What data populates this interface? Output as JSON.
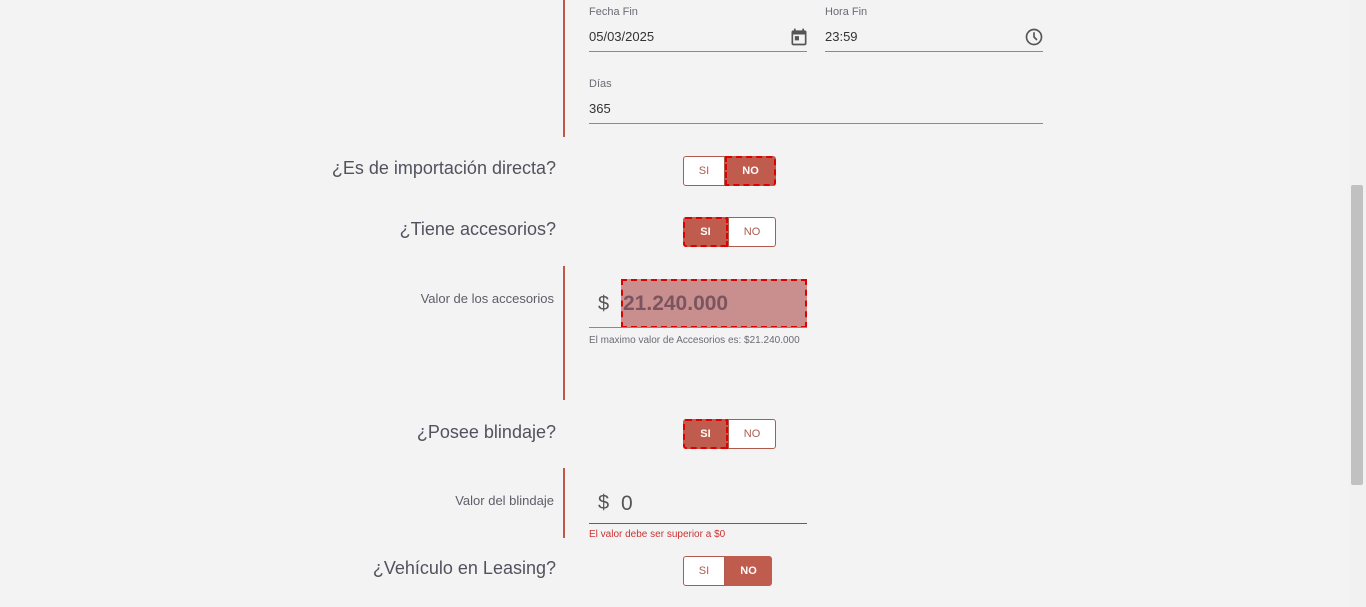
{
  "fecha_fin": {
    "label": "Fecha Fin",
    "value": "05/03/2025",
    "icon": "calendar-icon"
  },
  "hora_fin": {
    "label": "Hora Fin",
    "value": "23:59",
    "icon": "clock-icon"
  },
  "dias": {
    "label": "Días",
    "value": "365"
  },
  "importacion": {
    "question": "¿Es de importación directa?",
    "si": "SI",
    "no": "NO",
    "selected": "NO"
  },
  "accesorios": {
    "question": "¿Tiene accesorios?",
    "si": "SI",
    "no": "NO",
    "selected": "SI",
    "valor_label": "Valor de los accesorios",
    "currency": "$",
    "valor": "21.240.000",
    "hint": "El maximo valor de Accesorios es: $21.240.000"
  },
  "blindaje": {
    "question": "¿Posee blindaje?",
    "si": "SI",
    "no": "NO",
    "selected": "SI",
    "valor_label": "Valor del blindaje",
    "currency": "$",
    "valor": "0",
    "error": "El valor debe ser superior a $0"
  },
  "leasing": {
    "question": "¿Vehículo en Leasing?",
    "si": "SI",
    "no": "NO",
    "selected": "NO"
  },
  "colors": {
    "accent": "#bf5c4d",
    "error": "#cc3333",
    "focus_outline": "#e00000"
  }
}
